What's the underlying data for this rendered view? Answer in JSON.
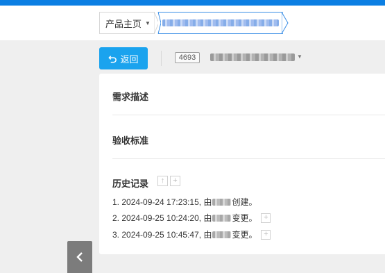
{
  "breadcrumb": {
    "home_label": "产品主页"
  },
  "toolbar": {
    "back_label": "返回",
    "item_id": "4693"
  },
  "sections": {
    "requirement_title": "需求描述",
    "acceptance_title": "验收标准",
    "history_title": "历史记录"
  },
  "history": [
    {
      "prefix": "1. 2024-09-24 17:23:15, 由",
      "suffix": "创建。"
    },
    {
      "prefix": "2. 2024-09-25 10:24:20, 由",
      "suffix": "变更。"
    },
    {
      "prefix": "3. 2024-09-25 10:45:47, 由",
      "suffix": "变更。"
    }
  ],
  "icons": {
    "back": "undo-arrow-icon",
    "sort": "arrow-up-icon",
    "expand": "plus-icon",
    "sidebar_toggle": "chevron-left-icon"
  },
  "colors": {
    "top_strip": "#0c7fe3",
    "primary_button": "#1aa3ee",
    "active_crumb_border": "#3a8ee6"
  }
}
